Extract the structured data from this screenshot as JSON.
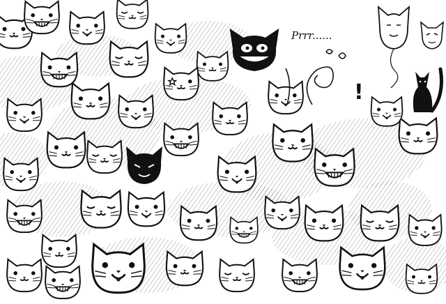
{
  "scene": {
    "subject": "doodle-cats-crowd",
    "style": "black-ink-line-art",
    "colors": {
      "ink": "#111111",
      "paper": "#ffffff",
      "hatch": "#555555"
    }
  },
  "annotations": {
    "purr_text": "Prrr......",
    "exclaim": "!"
  },
  "cats": [
    {
      "expr": "smile",
      "ink": false
    },
    {
      "expr": "grin",
      "ink": false
    },
    {
      "expr": "happy",
      "ink": false
    },
    {
      "expr": "sleep",
      "ink": false
    },
    {
      "expr": "happy",
      "ink": false
    },
    {
      "expr": "smile",
      "ink": false
    },
    {
      "expr": "grin",
      "ink": false
    },
    {
      "expr": "sleep",
      "ink": false
    },
    {
      "expr": "happy",
      "ink": false
    },
    {
      "expr": "smile",
      "ink": false
    },
    {
      "expr": "happy",
      "ink": false
    },
    {
      "expr": "star",
      "ink": false
    },
    {
      "expr": "smile",
      "ink": false
    },
    {
      "expr": "happy",
      "ink": false
    },
    {
      "expr": "grin",
      "ink": false
    },
    {
      "expr": "smile",
      "ink": false
    },
    {
      "expr": "sleep",
      "ink": false
    },
    {
      "expr": "happy",
      "ink": false
    },
    {
      "expr": "smile",
      "ink": false
    },
    {
      "expr": "grin",
      "ink": false
    },
    {
      "expr": "dark",
      "ink": true
    },
    {
      "expr": "smile",
      "ink": false
    },
    {
      "expr": "happy",
      "ink": false
    },
    {
      "expr": "grin",
      "ink": false
    },
    {
      "expr": "smile",
      "ink": false
    },
    {
      "expr": "sleep",
      "ink": false
    },
    {
      "expr": "happy",
      "ink": false
    },
    {
      "expr": "smile",
      "ink": false
    },
    {
      "expr": "grin",
      "ink": false
    },
    {
      "expr": "happy",
      "ink": false
    },
    {
      "expr": "smile",
      "ink": false
    },
    {
      "expr": "sleep",
      "ink": false
    },
    {
      "expr": "happy",
      "ink": false
    },
    {
      "expr": "smile",
      "ink": false
    },
    {
      "expr": "grin",
      "ink": false
    },
    {
      "expr": "happy",
      "ink": false
    },
    {
      "expr": "smile",
      "ink": false
    },
    {
      "expr": "sleep",
      "ink": false
    },
    {
      "expr": "grin",
      "ink": false
    },
    {
      "expr": "happy",
      "ink": false
    },
    {
      "expr": "smile",
      "ink": false
    },
    {
      "expr": "happy",
      "ink": false
    }
  ]
}
